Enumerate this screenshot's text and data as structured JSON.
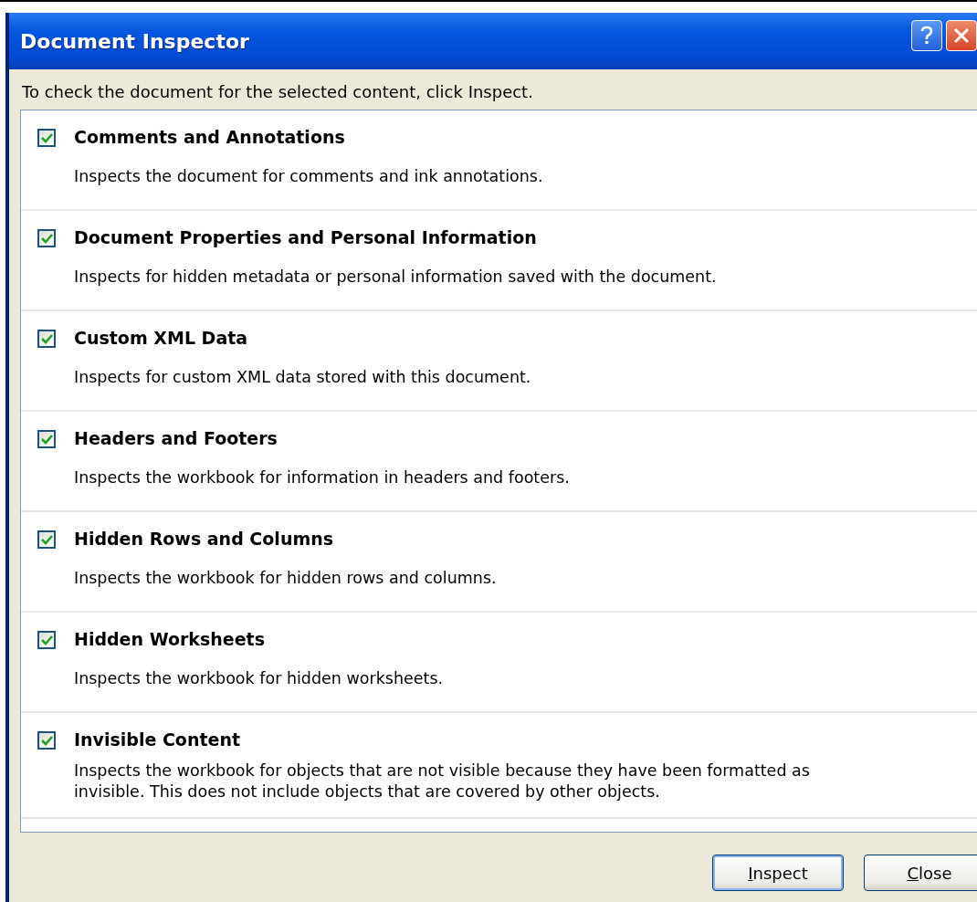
{
  "window": {
    "title": "Document Inspector"
  },
  "instructions": "To check the document for the selected content, click Inspect.",
  "items": [
    {
      "title": "Comments and Annotations",
      "description": "Inspects the document for comments and ink annotations.",
      "checked": true
    },
    {
      "title": "Document Properties and Personal Information",
      "description": "Inspects for hidden metadata or personal information saved with the document.",
      "checked": true
    },
    {
      "title": "Custom XML Data",
      "description": "Inspects for custom XML data stored with this document.",
      "checked": true
    },
    {
      "title": "Headers and Footers",
      "description": "Inspects the workbook for information in headers and footers.",
      "checked": true
    },
    {
      "title": "Hidden Rows and Columns",
      "description": "Inspects the workbook for hidden rows and columns.",
      "checked": true
    },
    {
      "title": "Hidden Worksheets",
      "description": "Inspects the workbook for hidden worksheets.",
      "checked": true
    },
    {
      "title": "Invisible Content",
      "description": "Inspects the workbook for objects that are not visible because they have been formatted as invisible. This does not include objects that are covered by other objects.",
      "checked": true
    }
  ],
  "buttons": [
    {
      "label": "Inspect",
      "default": true
    },
    {
      "label": "Close",
      "default": false
    }
  ]
}
